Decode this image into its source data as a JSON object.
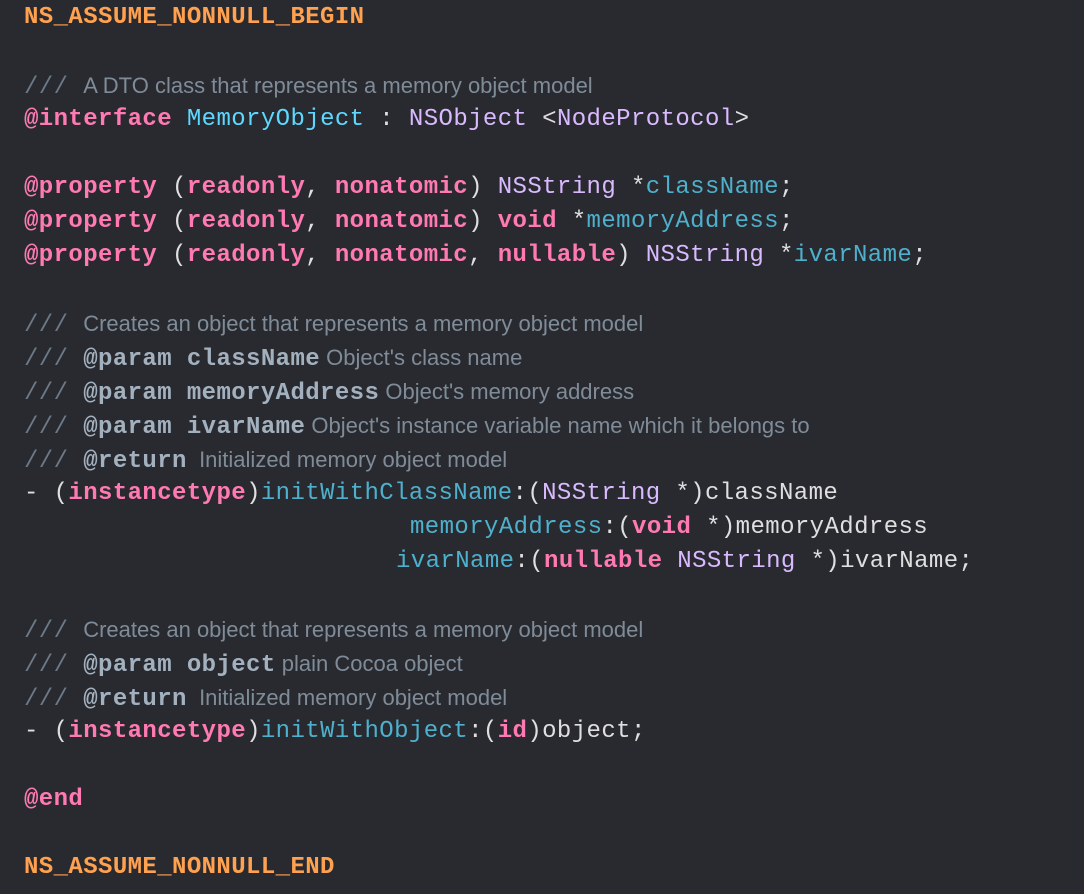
{
  "colors": {
    "background": "#292a30",
    "keyword": "#ff7ab2",
    "type": "#dabaff",
    "declaration": "#5dd8ff",
    "identifier": "#4eb0cc",
    "comment": "#7f8c98",
    "preprocessor": "#ffa14f"
  },
  "lines": [
    {
      "indent": 0,
      "tokens": [
        {
          "t": "NS_ASSUME_NONNULL_BEGIN",
          "c": "pre"
        }
      ]
    },
    {
      "indent": 0,
      "tokens": []
    },
    {
      "indent": 0,
      "tokens": [
        {
          "t": "/// ",
          "c": "slash"
        },
        {
          "t": "A DTO class that represents a memory object model",
          "c": "cmt"
        }
      ]
    },
    {
      "indent": 0,
      "tokens": [
        {
          "t": "@interface",
          "c": "kw"
        },
        {
          "t": " ",
          "c": "plain"
        },
        {
          "t": "MemoryObject",
          "c": "decl"
        },
        {
          "t": " : ",
          "c": "plain"
        },
        {
          "t": "NSObject",
          "c": "type"
        },
        {
          "t": " <",
          "c": "plain"
        },
        {
          "t": "NodeProtocol",
          "c": "type"
        },
        {
          "t": ">",
          "c": "plain"
        }
      ]
    },
    {
      "indent": 0,
      "tokens": []
    },
    {
      "indent": 0,
      "tokens": [
        {
          "t": "@property",
          "c": "kw"
        },
        {
          "t": " (",
          "c": "plain"
        },
        {
          "t": "readonly",
          "c": "kw"
        },
        {
          "t": ", ",
          "c": "plain"
        },
        {
          "t": "nonatomic",
          "c": "kw"
        },
        {
          "t": ") ",
          "c": "plain"
        },
        {
          "t": "NSString",
          "c": "type"
        },
        {
          "t": " *",
          "c": "plain"
        },
        {
          "t": "className",
          "c": "ident"
        },
        {
          "t": ";",
          "c": "plain"
        }
      ]
    },
    {
      "indent": 0,
      "tokens": [
        {
          "t": "@property",
          "c": "kw"
        },
        {
          "t": " (",
          "c": "plain"
        },
        {
          "t": "readonly",
          "c": "kw"
        },
        {
          "t": ", ",
          "c": "plain"
        },
        {
          "t": "nonatomic",
          "c": "kw"
        },
        {
          "t": ") ",
          "c": "plain"
        },
        {
          "t": "void",
          "c": "kw"
        },
        {
          "t": " *",
          "c": "plain"
        },
        {
          "t": "memoryAddress",
          "c": "ident"
        },
        {
          "t": ";",
          "c": "plain"
        }
      ]
    },
    {
      "indent": 0,
      "tokens": [
        {
          "t": "@property",
          "c": "kw"
        },
        {
          "t": " (",
          "c": "plain"
        },
        {
          "t": "readonly",
          "c": "kw"
        },
        {
          "t": ", ",
          "c": "plain"
        },
        {
          "t": "nonatomic",
          "c": "kw"
        },
        {
          "t": ", ",
          "c": "plain"
        },
        {
          "t": "nullable",
          "c": "kw"
        },
        {
          "t": ") ",
          "c": "plain"
        },
        {
          "t": "NSString",
          "c": "type"
        },
        {
          "t": " *",
          "c": "plain"
        },
        {
          "t": "ivarName",
          "c": "ident"
        },
        {
          "t": ";",
          "c": "plain"
        }
      ]
    },
    {
      "indent": 0,
      "tokens": []
    },
    {
      "indent": 0,
      "tokens": [
        {
          "t": "/// ",
          "c": "slash"
        },
        {
          "t": "Creates an object that represents a memory object model",
          "c": "cmt"
        }
      ]
    },
    {
      "indent": 0,
      "tokens": [
        {
          "t": "/// ",
          "c": "slash"
        },
        {
          "t": "@param className",
          "c": "doc"
        },
        {
          "t": " Object's class name",
          "c": "cmt"
        }
      ]
    },
    {
      "indent": 0,
      "tokens": [
        {
          "t": "/// ",
          "c": "slash"
        },
        {
          "t": "@param memoryAddress",
          "c": "doc"
        },
        {
          "t": " Object's memory address",
          "c": "cmt"
        }
      ]
    },
    {
      "indent": 0,
      "tokens": [
        {
          "t": "/// ",
          "c": "slash"
        },
        {
          "t": "@param ivarName",
          "c": "doc"
        },
        {
          "t": " Object's instance variable name which it belongs to",
          "c": "cmt"
        }
      ]
    },
    {
      "indent": 0,
      "tokens": [
        {
          "t": "/// ",
          "c": "slash"
        },
        {
          "t": "@return",
          "c": "doc"
        },
        {
          "t": "  Initialized memory object model",
          "c": "cmt"
        }
      ]
    },
    {
      "indent": 0,
      "tokens": [
        {
          "t": "- (",
          "c": "plain"
        },
        {
          "t": "instancetype",
          "c": "kw"
        },
        {
          "t": ")",
          "c": "plain"
        },
        {
          "t": "initWithClassName",
          "c": "ident"
        },
        {
          "t": ":(",
          "c": "plain"
        },
        {
          "t": "NSString",
          "c": "type"
        },
        {
          "t": " *)className",
          "c": "plain"
        }
      ]
    },
    {
      "indent": 1,
      "tokens": [
        {
          "t": "memoryAddress",
          "c": "ident"
        },
        {
          "t": ":(",
          "c": "plain"
        },
        {
          "t": "void",
          "c": "kw"
        },
        {
          "t": " *)memoryAddress",
          "c": "plain"
        }
      ]
    },
    {
      "indent": 2,
      "tokens": [
        {
          "t": "ivarName",
          "c": "ident"
        },
        {
          "t": ":(",
          "c": "plain"
        },
        {
          "t": "nullable",
          "c": "kw"
        },
        {
          "t": " ",
          "c": "plain"
        },
        {
          "t": "NSString",
          "c": "type"
        },
        {
          "t": " *)ivarName;",
          "c": "plain"
        }
      ]
    },
    {
      "indent": 0,
      "tokens": []
    },
    {
      "indent": 0,
      "tokens": [
        {
          "t": "/// ",
          "c": "slash"
        },
        {
          "t": "Creates an object that represents a memory object model",
          "c": "cmt"
        }
      ]
    },
    {
      "indent": 0,
      "tokens": [
        {
          "t": "/// ",
          "c": "slash"
        },
        {
          "t": "@param object",
          "c": "doc"
        },
        {
          "t": " plain Cocoa object",
          "c": "cmt"
        }
      ]
    },
    {
      "indent": 0,
      "tokens": [
        {
          "t": "/// ",
          "c": "slash"
        },
        {
          "t": "@return",
          "c": "doc"
        },
        {
          "t": "  Initialized memory object model",
          "c": "cmt"
        }
      ]
    },
    {
      "indent": 0,
      "tokens": [
        {
          "t": "- (",
          "c": "plain"
        },
        {
          "t": "instancetype",
          "c": "kw"
        },
        {
          "t": ")",
          "c": "plain"
        },
        {
          "t": "initWithObject",
          "c": "ident"
        },
        {
          "t": ":(",
          "c": "plain"
        },
        {
          "t": "id",
          "c": "kw"
        },
        {
          "t": ")object;",
          "c": "plain"
        }
      ]
    },
    {
      "indent": 0,
      "tokens": []
    },
    {
      "indent": 0,
      "tokens": [
        {
          "t": "@end",
          "c": "kw"
        }
      ]
    },
    {
      "indent": 0,
      "tokens": []
    },
    {
      "indent": 0,
      "tokens": [
        {
          "t": "NS_ASSUME_NONNULL_END",
          "c": "pre"
        }
      ]
    }
  ]
}
